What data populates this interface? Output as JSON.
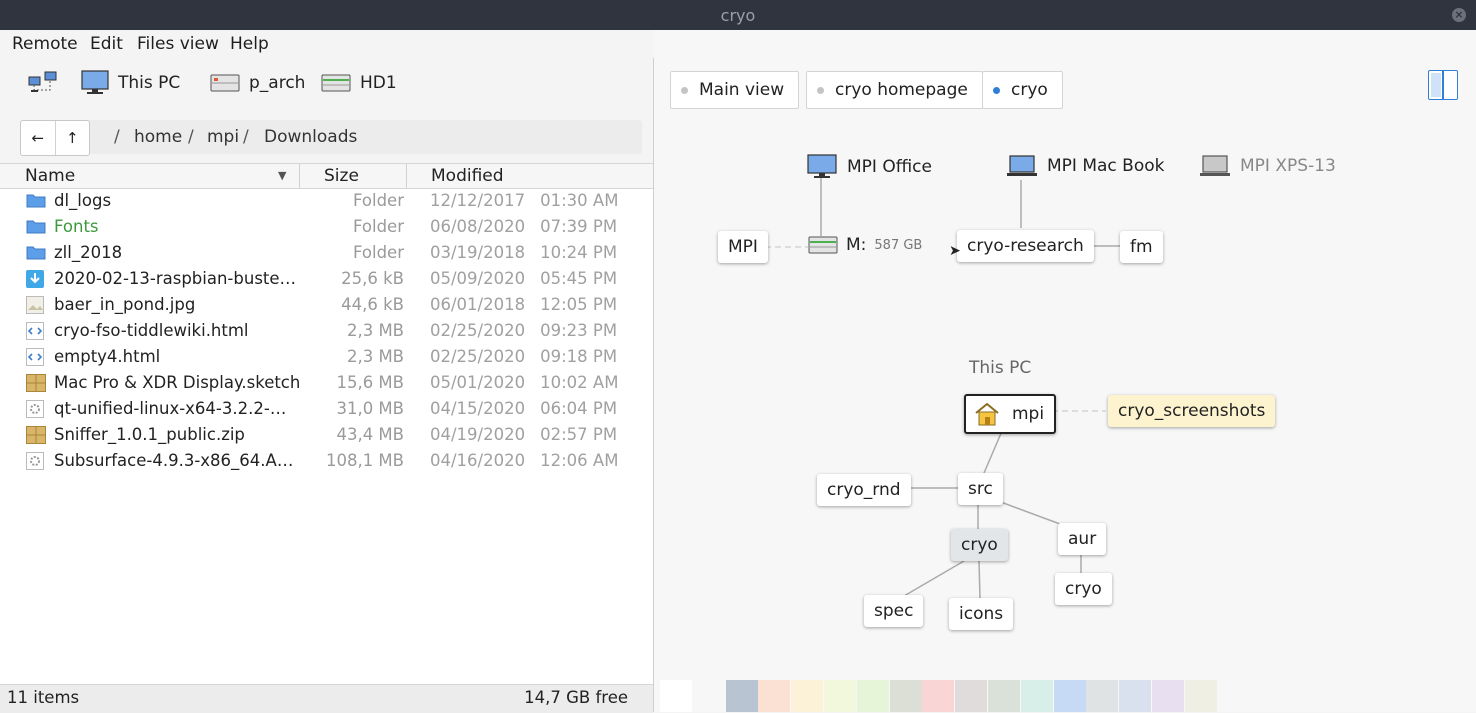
{
  "window": {
    "title": "cryo"
  },
  "menu": [
    "Remote",
    "Edit",
    "Files view",
    "Help"
  ],
  "devices": [
    {
      "label": "",
      "icon": "network-icon"
    },
    {
      "label": "This PC",
      "icon": "monitor-icon"
    },
    {
      "label": "p_arch",
      "icon": "drive-icon"
    },
    {
      "label": "HD1",
      "icon": "drive-icon"
    }
  ],
  "path": {
    "crumbs": [
      "home",
      "mpi",
      "Downloads"
    ]
  },
  "columns": {
    "name": "Name",
    "size": "Size",
    "modified": "Modified"
  },
  "files": [
    {
      "name": "dl_logs",
      "size": "Folder",
      "date": "12/12/2017",
      "time": "01:30 AM",
      "icon": "folder-icon"
    },
    {
      "name": "Fonts",
      "size": "Folder",
      "date": "06/08/2020",
      "time": "07:39 PM",
      "icon": "folder-icon",
      "color": "#3c9a3c"
    },
    {
      "name": "zll_2018",
      "size": "Folder",
      "date": "03/19/2018",
      "time": "10:24 PM",
      "icon": "folder-icon"
    },
    {
      "name": "2020-02-13-raspbian-buste…",
      "size": "25,6 kB",
      "date": "05/09/2020",
      "time": "05:45 PM",
      "icon": "download-icon"
    },
    {
      "name": "baer_in_pond.jpg",
      "size": "44,6 kB",
      "date": "06/01/2018",
      "time": "12:05 PM",
      "icon": "image-icon"
    },
    {
      "name": "cryo-fso-tiddlewiki.html",
      "size": "2,3 MB",
      "date": "02/25/2020",
      "time": "09:23 PM",
      "icon": "html-icon"
    },
    {
      "name": "empty4.html",
      "size": "2,3 MB",
      "date": "02/25/2020",
      "time": "09:18 PM",
      "icon": "html-icon"
    },
    {
      "name": "Mac Pro & XDR Display.sketch",
      "size": "15,6 MB",
      "date": "05/01/2020",
      "time": "10:02 AM",
      "icon": "archive-icon"
    },
    {
      "name": "qt-unified-linux-x64-3.2.2-…",
      "size": "31,0 MB",
      "date": "04/15/2020",
      "time": "06:04 PM",
      "icon": "executable-icon"
    },
    {
      "name": "Sniffer_1.0.1_public.zip",
      "size": "43,4 MB",
      "date": "04/19/2020",
      "time": "02:57 PM",
      "icon": "archive-icon"
    },
    {
      "name": "Subsurface-4.9.3-x86_64.A…",
      "size": "108,1 MB",
      "date": "04/16/2020",
      "time": "12:06 AM",
      "icon": "executable-icon"
    }
  ],
  "status": {
    "count": "11 items",
    "free": "14,7 GB free"
  },
  "tabs": [
    {
      "label": "Main view",
      "active": false
    },
    {
      "label": "cryo homepage",
      "active": false
    },
    {
      "label": "cryo",
      "active": true
    }
  ],
  "graph": {
    "computers": [
      "MPI Office",
      "MPI Mac Book",
      "MPI XPS-13"
    ],
    "mpi": "MPI",
    "drive_label": "M:",
    "drive_size": "587 GB",
    "research": "cryo-research",
    "fm": "fm",
    "thispc": "This PC",
    "root": "mpi",
    "screenshots": "cryo_screenshots",
    "src": "src",
    "cryo_rnd": "cryo_rnd",
    "cryo": "cryo",
    "aur": "aur",
    "cryo2": "cryo",
    "spec": "spec",
    "icons": "icons"
  },
  "accent": "#2f7fd8",
  "swatches": [
    "#ffffff",
    "#f7f7f7",
    "#b8c4d1",
    "#fbe1d4",
    "#fcf2d8",
    "#f1f8dc",
    "#e6f5d8",
    "#dcdfd6",
    "#f9d5d5",
    "#e0dcdc",
    "#d9e1d9",
    "#d8efe9",
    "#c6daf5",
    "#dfe3e3",
    "#d9e0ee",
    "#e8e0f1",
    "#f0efe4"
  ]
}
